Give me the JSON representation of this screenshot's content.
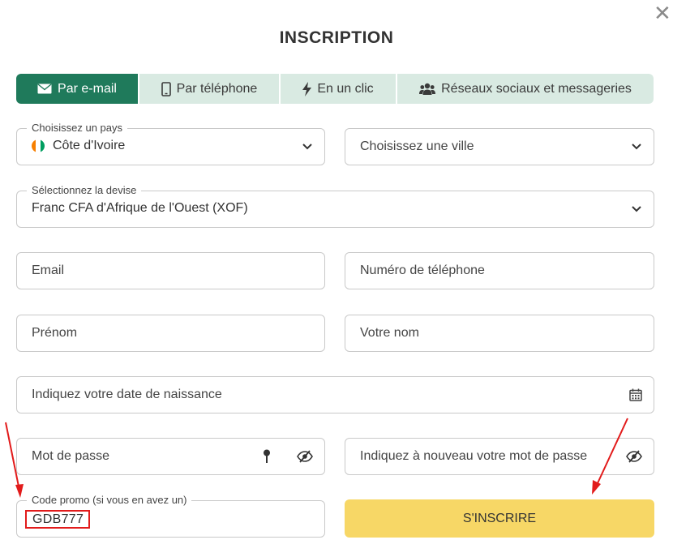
{
  "dialog": {
    "close_symbol": "✕",
    "title": "INSCRIPTION"
  },
  "tabs": [
    {
      "label": "Par e-mail",
      "icon": "envelope-icon",
      "active": true
    },
    {
      "label": "Par téléphone",
      "icon": "phone-icon",
      "active": false
    },
    {
      "label": "En un clic",
      "icon": "lightning-icon",
      "active": false
    },
    {
      "label": "Réseaux sociaux et messageries",
      "icon": "users-icon",
      "active": false
    }
  ],
  "form": {
    "country": {
      "label": "Choisissez un pays",
      "value": "Côte d'Ivoire"
    },
    "city": {
      "placeholder": "Choisissez une ville"
    },
    "currency": {
      "label": "Sélectionnez la devise",
      "value": "Franc CFA d'Afrique de l'Ouest (XOF)"
    },
    "email": {
      "placeholder": "Email"
    },
    "phone": {
      "placeholder": "Numéro de téléphone"
    },
    "first_name": {
      "placeholder": "Prénom"
    },
    "last_name": {
      "placeholder": "Votre nom"
    },
    "birthdate": {
      "placeholder": "Indiquez votre date de naissance"
    },
    "password": {
      "placeholder": "Mot de passe"
    },
    "password_confirm": {
      "placeholder": "Indiquez à nouveau votre mot de passe"
    },
    "promo": {
      "label": "Code promo (si vous en avez un)",
      "value": "GDB777"
    },
    "submit_label": "S'INSCRIRE"
  },
  "colors": {
    "accent_green": "#1f7a5b",
    "tab_bg": "#d9eae2",
    "submit_yellow": "#f7d766",
    "annotation_red": "#e21b1b"
  }
}
